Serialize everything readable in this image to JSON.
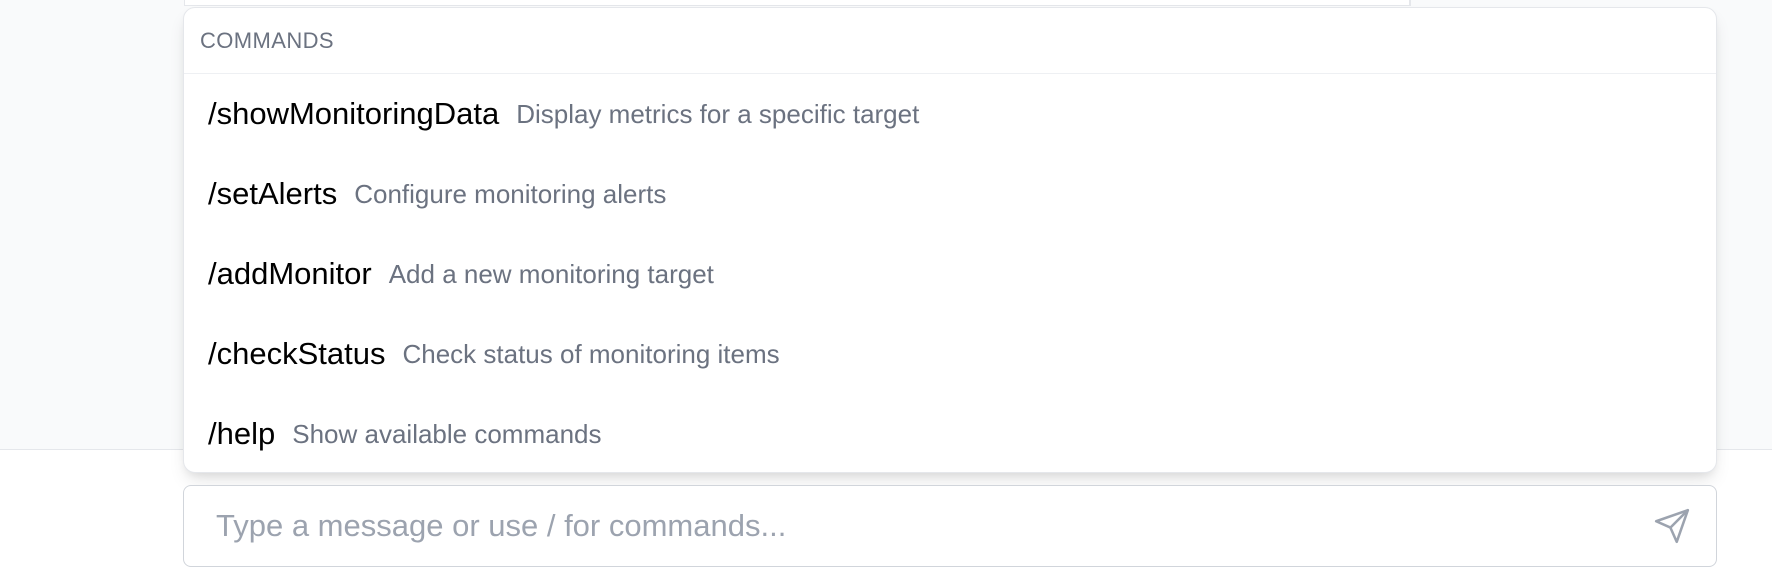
{
  "commands_popup": {
    "header": "COMMANDS",
    "items": [
      {
        "name": "/showMonitoringData",
        "description": "Display metrics for a specific target"
      },
      {
        "name": "/setAlerts",
        "description": "Configure monitoring alerts"
      },
      {
        "name": "/addMonitor",
        "description": "Add a new monitoring target"
      },
      {
        "name": "/checkStatus",
        "description": "Check status of monitoring items"
      },
      {
        "name": "/help",
        "description": "Show available commands"
      }
    ]
  },
  "composer": {
    "placeholder": "Type a message or use / for commands...",
    "value": "",
    "send_icon": "send-icon"
  },
  "colors": {
    "page_background": "#f9fafb",
    "border": "#e5e7eb",
    "muted_text": "#6b7280",
    "placeholder": "#9ca3af",
    "icon": "#9ca3af"
  }
}
